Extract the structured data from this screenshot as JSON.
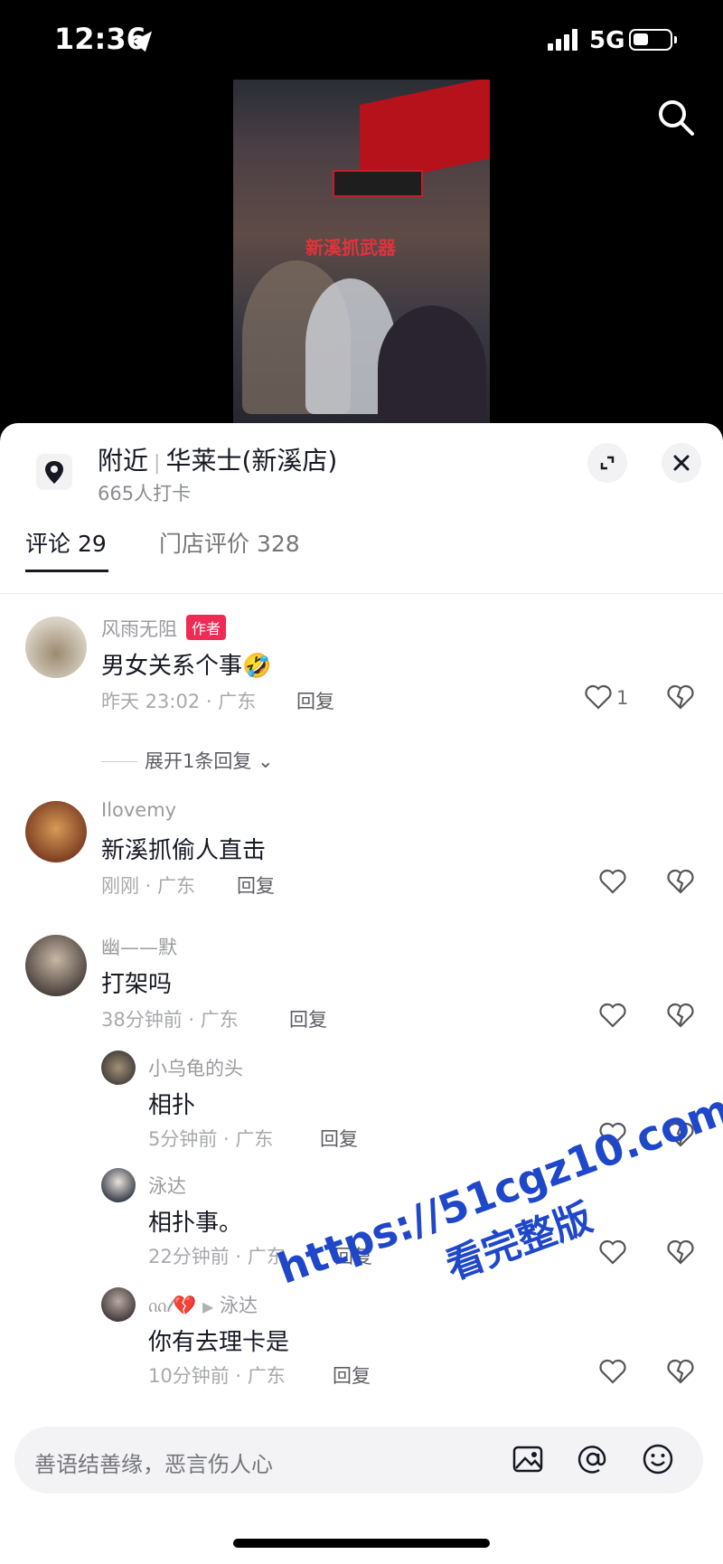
{
  "status_bar": {
    "time": "12:36",
    "network": "5G"
  },
  "video": {
    "caption": "新溪抓武器"
  },
  "location": {
    "label": "附近",
    "store": "华莱士(新溪店)",
    "checkins": "665人打卡"
  },
  "tabs": [
    {
      "label": "评论 29"
    },
    {
      "label": "门店评价 328"
    }
  ],
  "comments": [
    {
      "name": "风雨无阻",
      "badge": "作者",
      "text": "男女关系个事🤣",
      "meta": "昨天 23:02 · 广东",
      "reply": "回复",
      "likes": "1",
      "expand": "展开1条回复"
    },
    {
      "name": "Ilovemy",
      "text": "新溪抓偷人直击",
      "meta": "刚刚 · 广东",
      "reply": "回复"
    },
    {
      "name": "幽——默",
      "text": "打架吗",
      "meta": "38分钟前 · 广东",
      "reply": "回复"
    }
  ],
  "replies": [
    {
      "name": "小乌龟的头",
      "text": "相扑",
      "meta": "5分钟前 · 广东",
      "reply": "回复"
    },
    {
      "name": "泳达",
      "text": "相扑事。",
      "meta": "22分钟前 · 广东",
      "reply": "回复"
    },
    {
      "name": "ᦶ𝓁💔",
      "to": "泳达",
      "text": "你有去理卡是",
      "meta": "10分钟前 · 广东",
      "reply": "回复"
    }
  ],
  "input": {
    "placeholder": "善语结善缘，恶言伤人心"
  },
  "watermark": {
    "line1": "https://51cgz10.com",
    "line2": "看完整版"
  },
  "colors": {
    "accent": "#ee2a55",
    "watermark": "#1f47c9"
  }
}
